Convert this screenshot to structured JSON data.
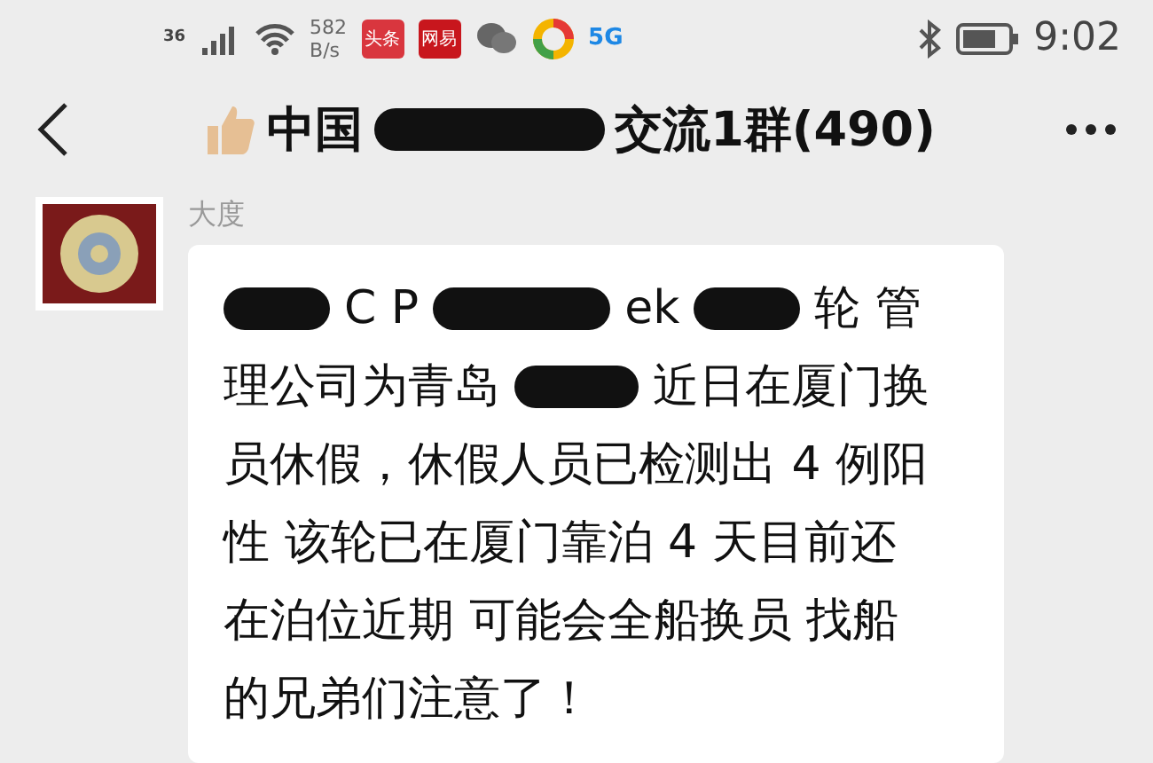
{
  "status_bar": {
    "network": "36",
    "speed": [
      "582",
      "B/s"
    ],
    "app_icons": [
      {
        "kind": "badge",
        "label": "头条",
        "color": "#d9363e"
      },
      {
        "kind": "badge",
        "label": "网易",
        "color": "#c8161d"
      },
      {
        "kind": "chat"
      },
      {
        "kind": "ring"
      },
      {
        "kind": "text",
        "label": "5G",
        "color": "#1e88e5"
      }
    ],
    "time": "9:02"
  },
  "header": {
    "title_parts": [
      {
        "kind": "text",
        "text": "中国"
      },
      {
        "kind": "redaction"
      },
      {
        "kind": "text",
        "text": "交流1群(490)"
      }
    ]
  },
  "messages": [
    {
      "sender": "大度",
      "lines": [
        [
          {
            "kind": "redaction"
          },
          {
            "kind": "text",
            "text": "C P"
          },
          {
            "kind": "redaction"
          },
          {
            "kind": "text",
            "text": "ek"
          },
          {
            "kind": "redaction"
          },
          {
            "kind": "text",
            "text": "轮 管"
          }
        ],
        [
          {
            "kind": "text",
            "text": "理公司为青岛"
          },
          {
            "kind": "redaction"
          },
          {
            "kind": "text",
            "text": "近日在厦门换"
          }
        ],
        [
          {
            "kind": "text",
            "text": "员休假，休假人员已检测出 4 例阳"
          }
        ],
        [
          {
            "kind": "text",
            "text": "性 该轮已在厦门靠泊 4 天目前还"
          }
        ],
        [
          {
            "kind": "text",
            "text": "在泊位近期 可能会全船换员 找船"
          }
        ],
        [
          {
            "kind": "text",
            "text": "的兄弟们注意了！"
          }
        ]
      ]
    }
  ]
}
